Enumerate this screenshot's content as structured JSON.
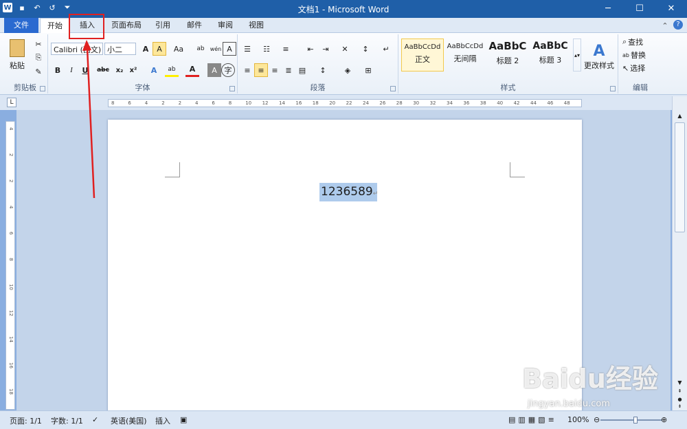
{
  "window": {
    "title": "文档1 - Microsoft Word"
  },
  "qat": {
    "logo": "W"
  },
  "tabs": {
    "file": "文件",
    "home": "开始",
    "insert": "插入",
    "layout": "页面布局",
    "references": "引用",
    "mailings": "邮件",
    "review": "审阅",
    "view": "视图"
  },
  "ribbon": {
    "clipboard": {
      "label": "剪贴板",
      "paste": "粘贴"
    },
    "font": {
      "label": "字体",
      "font_name": "Calibri (西文)",
      "font_size": "小二",
      "bold": "B",
      "italic": "I",
      "underline": "U",
      "strike": "abc",
      "subscript": "x₂",
      "superscript": "x²",
      "grow": "A",
      "case": "Aa",
      "wen": "wén",
      "fontcolor": "A"
    },
    "paragraph": {
      "label": "段落"
    },
    "styles": {
      "label": "样式",
      "items": [
        {
          "sample": "AaBbCcDd",
          "name": "正文"
        },
        {
          "sample": "AaBbCcDd",
          "name": "无间隔"
        },
        {
          "sample": "AaBbC",
          "name": "标题 2"
        },
        {
          "sample": "AaBbC",
          "name": "标题 3"
        }
      ],
      "change": "更改样式"
    },
    "editing": {
      "label": "编辑",
      "find": "查找",
      "replace": "替换",
      "select": "选择"
    }
  },
  "ruler": {
    "h_ticks": [
      "8",
      "6",
      "4",
      "2",
      "2",
      "4",
      "6",
      "8",
      "10",
      "12",
      "14",
      "16",
      "18",
      "20",
      "22",
      "24",
      "26",
      "28",
      "30",
      "32",
      "34",
      "36",
      "38",
      "40",
      "42",
      "44",
      "46",
      "48"
    ],
    "v_ticks": [
      "4",
      "2",
      "2",
      "4",
      "6",
      "8",
      "10",
      "12",
      "14",
      "16",
      "18"
    ]
  },
  "document": {
    "text": "1236589"
  },
  "status": {
    "page": "页面: 1/1",
    "words": "字数: 1/1",
    "language": "英语(美国)",
    "mode": "插入",
    "zoom": "100%"
  },
  "watermark": {
    "brand": "Baidu经验",
    "url": "jingyan.baidu.com"
  },
  "colors": {
    "accent": "#2a6ad0",
    "annotation": "#e02020",
    "selection": "#aecbec"
  }
}
